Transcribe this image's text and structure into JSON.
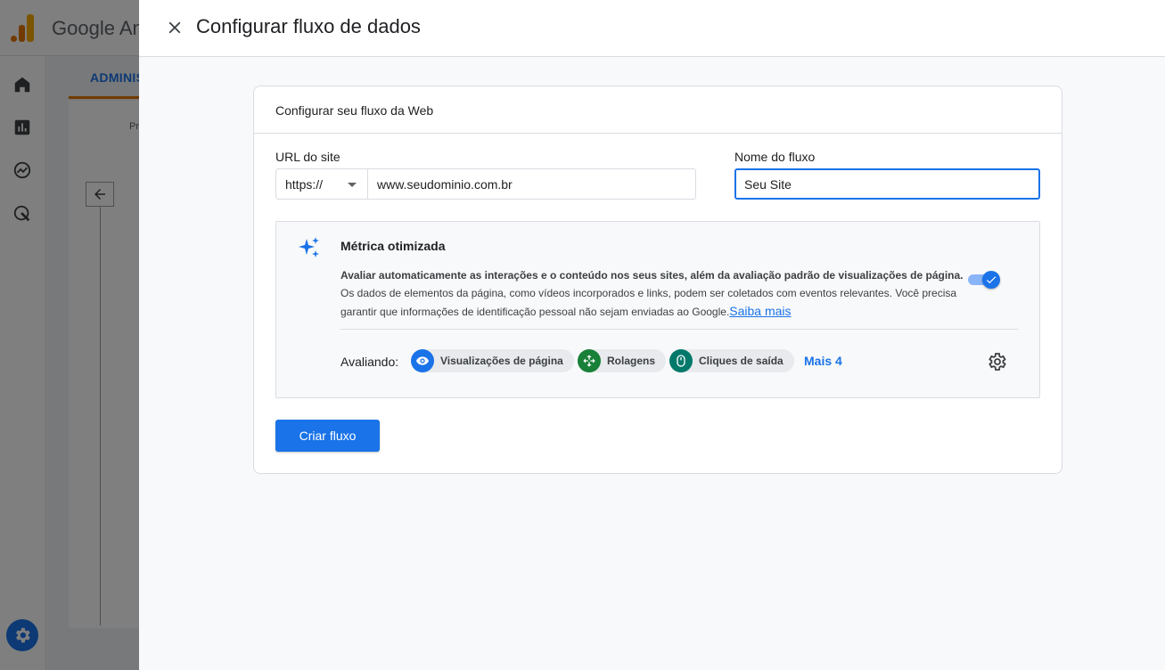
{
  "background": {
    "brand": "Google An",
    "tab": "ADMINIS",
    "small_text": "Pr"
  },
  "dialog": {
    "title": "Configurar fluxo de dados",
    "card_title": "Configurar seu fluxo da Web",
    "url_label": "URL do site",
    "protocol_value": "https://",
    "url_value": "www.seudominio.com.br",
    "stream_name_label": "Nome do fluxo",
    "stream_name_value": "Seu Site",
    "enhanced": {
      "title": "Métrica otimizada",
      "desc_bold": "Avaliar automaticamente as interações e o conteúdo nos seus sites, além da avaliação padrão de visualizações de página.",
      "desc_rest": "Os dados de elementos da página, como vídeos incorporados e links, podem ser coletados com eventos relevantes. Você precisa garantir que informações de identificação pessoal não sejam enviadas ao Google.",
      "learn_more": "Saiba mais",
      "toggle_on": true,
      "measuring_label": "Avaliando:",
      "chips": [
        {
          "label": "Visualizações de página",
          "icon": "eye-icon",
          "color": "#1a73e8"
        },
        {
          "label": "Rolagens",
          "icon": "move-arrows-icon",
          "color": "#188038"
        },
        {
          "label": "Cliques de saída",
          "icon": "mouse-icon",
          "color": "#00796b"
        }
      ],
      "more": "Mais 4"
    },
    "create_button": "Criar fluxo"
  },
  "colors": {
    "accent": "#1a73e8",
    "brand_orange": "#e37400"
  }
}
